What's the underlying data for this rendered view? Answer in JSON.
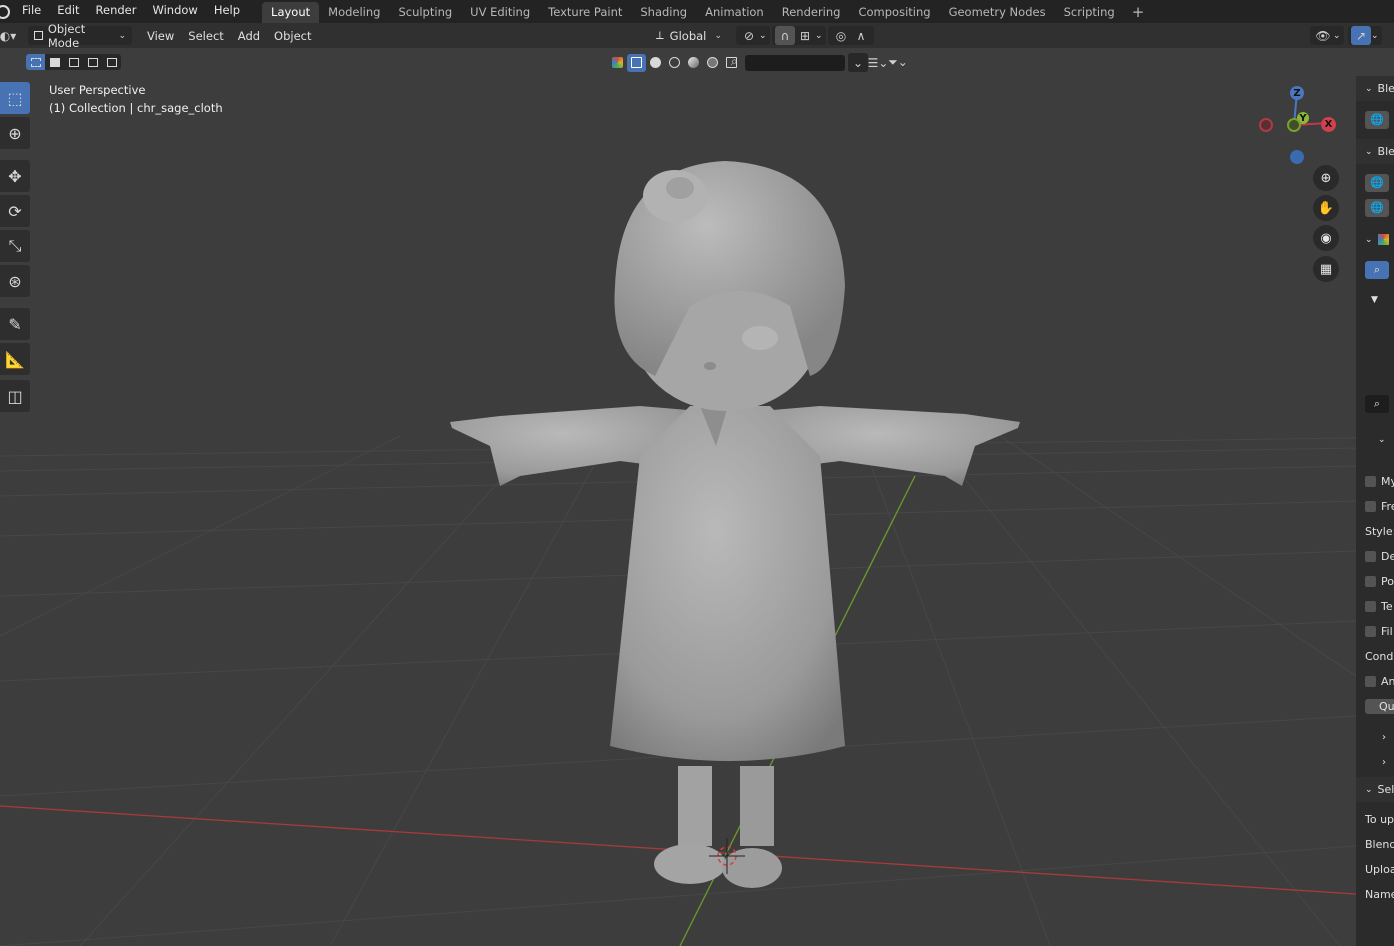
{
  "menu": [
    "File",
    "Edit",
    "Render",
    "Window",
    "Help"
  ],
  "workspaces": [
    {
      "label": "Layout",
      "active": true
    },
    {
      "label": "Modeling"
    },
    {
      "label": "Sculpting"
    },
    {
      "label": "UV Editing"
    },
    {
      "label": "Texture Paint"
    },
    {
      "label": "Shading"
    },
    {
      "label": "Animation"
    },
    {
      "label": "Rendering"
    },
    {
      "label": "Compositing"
    },
    {
      "label": "Geometry Nodes"
    },
    {
      "label": "Scripting"
    }
  ],
  "header": {
    "mode": "Object Mode",
    "menus": [
      "View",
      "Select",
      "Add",
      "Object"
    ],
    "orientation": "Global"
  },
  "viewport": {
    "perspective": "User Perspective",
    "collection": "(1) Collection | chr_sage_cloth",
    "colors": {
      "background": "#3d3d3d",
      "grid": "#474747",
      "x_axis": "#a83a3a",
      "y_axis": "#6a9a2e",
      "model": "#a8a8a8",
      "accent": "#4772b3"
    }
  },
  "gizmo": {
    "z": "Z",
    "y": "Y",
    "x": "X"
  },
  "toolbar": [
    "select-box-icon",
    "cursor-icon",
    "move-icon",
    "rotate-icon",
    "scale-icon",
    "transform-icon",
    "annotate-icon",
    "measure-icon",
    "add-cube-icon"
  ],
  "sidebar": {
    "rows": [
      "Ble",
      "Ble",
      "My",
      "Fre",
      "Style:",
      "De",
      "Po",
      "Te",
      "Fil",
      "Condi",
      "An",
      "Qu",
      "Sel",
      "To upl",
      "Blend",
      "Uploa",
      "Name"
    ]
  }
}
